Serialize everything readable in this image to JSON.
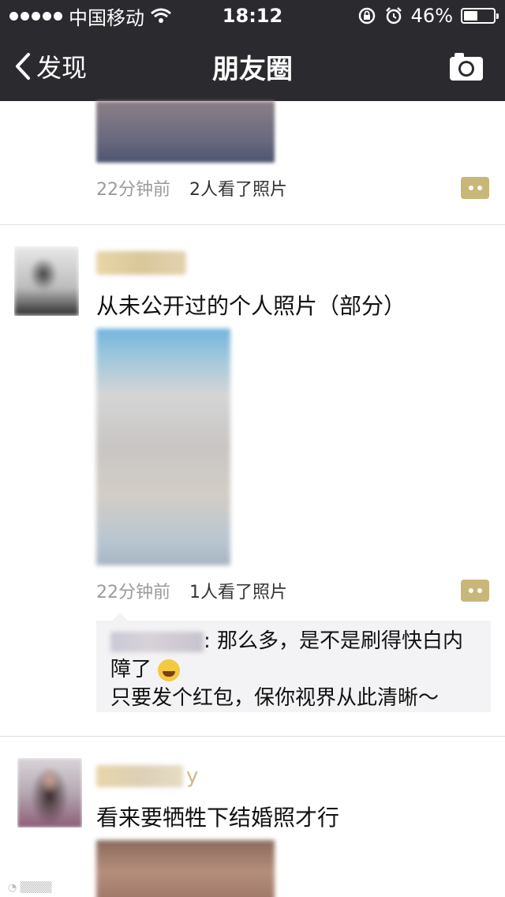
{
  "status_bar": {
    "carrier": "中国移动",
    "time": "18:12",
    "battery_percent": "46%",
    "battery_level": 0.46
  },
  "nav": {
    "back_label": "发现",
    "title": "朋友圈",
    "camera_icon": "camera-icon"
  },
  "posts": [
    {
      "time": "22分钟前",
      "views": "2人看了照片"
    },
    {
      "text": "从未公开过的个人照片（部分）",
      "time": "22分钟前",
      "views": "1人看了照片",
      "comment": {
        "line1": "那么多，是不是刷得快白内",
        "line2": "障了",
        "emoji": "laughing-tears-emoji",
        "reply": "只要发个红包，保你视界从此清晰～"
      }
    },
    {
      "name_suffix": "y",
      "text": "看来要牺牲下结婚照才行"
    }
  ],
  "colors": {
    "nav_bg": "#2b2a2f",
    "more_btn": "#c9b77a",
    "comment_bg": "#f3f3f5"
  }
}
